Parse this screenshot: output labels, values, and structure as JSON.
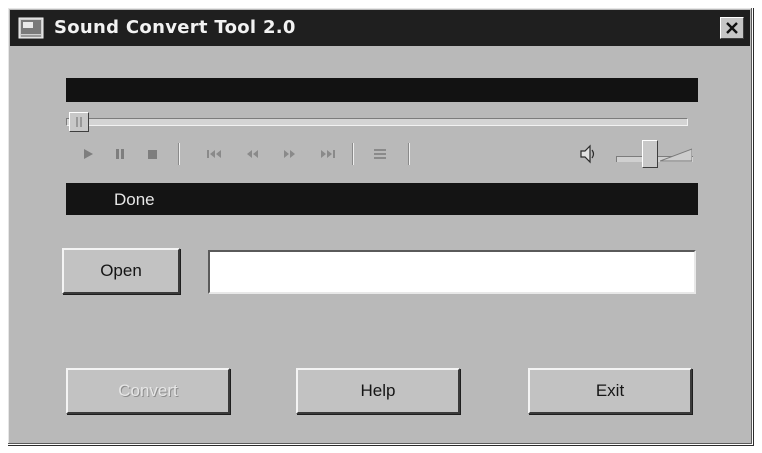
{
  "window": {
    "title": "Sound Convert Tool 2.0",
    "colors": {
      "face": "#b9b9b9",
      "titlebar": "#1f1f1f",
      "display": "#121212"
    }
  },
  "status": {
    "text": "Done"
  },
  "file": {
    "path_value": ""
  },
  "buttons": {
    "open_label": "Open",
    "convert_label": "Convert",
    "help_label": "Help",
    "exit_label": "Exit"
  },
  "transport_icons": [
    "play-icon",
    "pause-icon",
    "stop-icon",
    "skip-back-icon",
    "rewind-icon",
    "fast-forward-icon",
    "skip-forward-icon",
    "repeat-icon"
  ],
  "volume": {
    "level": 0.45
  }
}
